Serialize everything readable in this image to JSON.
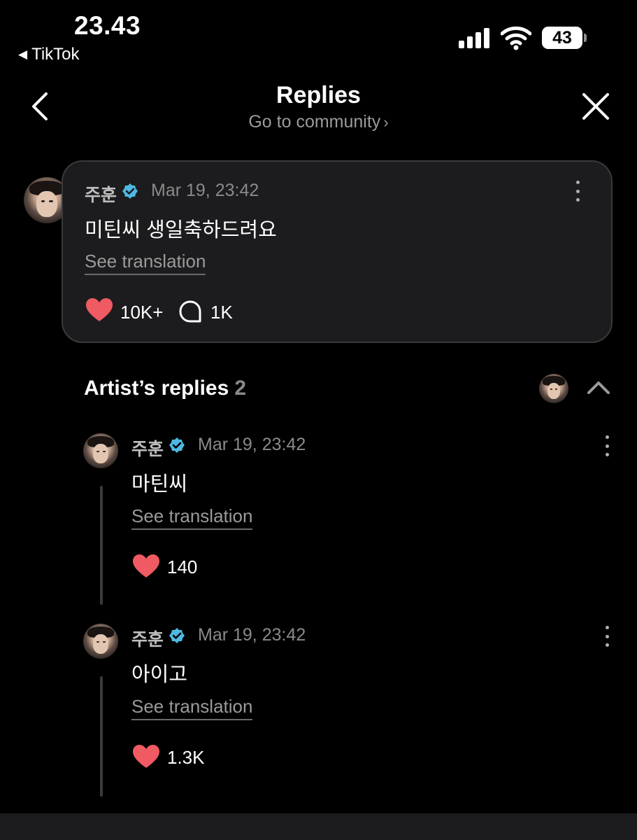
{
  "status_bar": {
    "time": "23.43",
    "back_app": "TikTok",
    "battery": "43",
    "battery_level_percent": 43
  },
  "header": {
    "title": "Replies",
    "subtitle": "Go to community",
    "chevron": "›"
  },
  "main_comment": {
    "author": "주훈",
    "date": "Mar 19, 23:42",
    "text": "미틴씨 생일축하드려요",
    "see_translation": "See translation",
    "likes": "10K+",
    "replies": "1K"
  },
  "artist_replies": {
    "title": "Artist’s replies",
    "count": "2",
    "items": [
      {
        "author": "주훈",
        "date": "Mar 19, 23:42",
        "text": "마틴씨",
        "see_translation": "See translation",
        "likes": "140"
      },
      {
        "author": "주훈",
        "date": "Mar 19, 23:42",
        "text": "아이고",
        "see_translation": "See translation",
        "likes": "1.3K"
      }
    ]
  },
  "colors": {
    "background": "#000000",
    "card": "#1c1c1e",
    "heart": "#f05a63",
    "verified": "#4fb8e3"
  },
  "icons": [
    "back-arrow-icon",
    "close-icon",
    "verified-icon",
    "more-options-icon",
    "heart-icon",
    "comment-bubble-icon",
    "chevron-up-icon",
    "signal-icon",
    "wifi-icon",
    "battery-icon"
  ]
}
